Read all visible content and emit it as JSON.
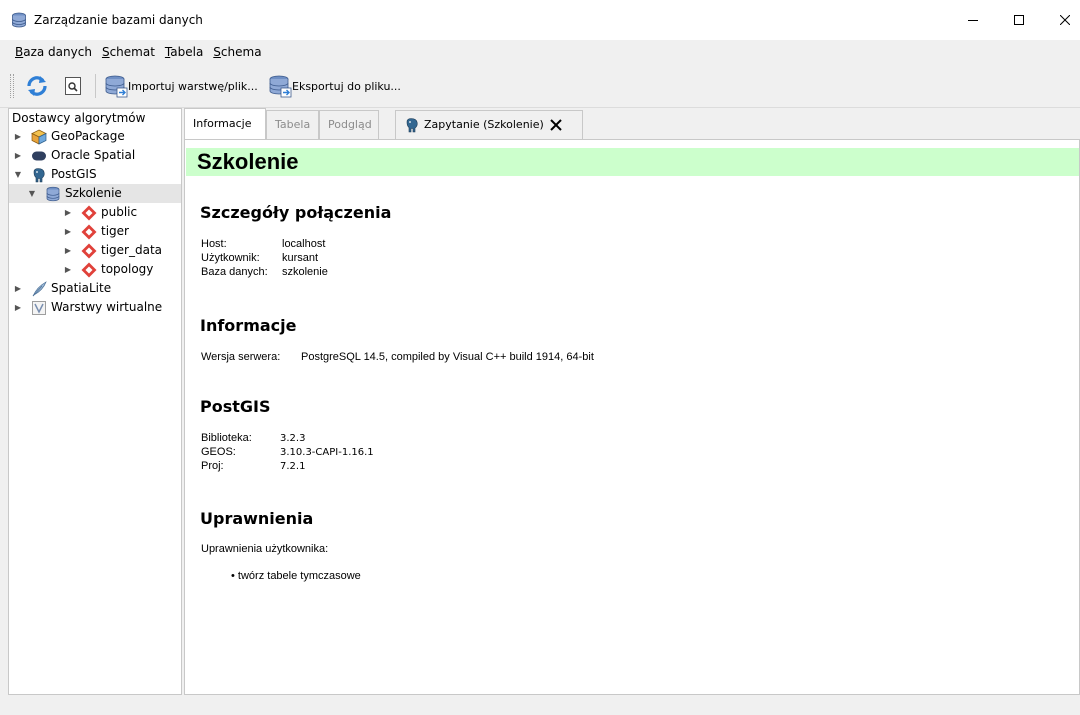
{
  "window": {
    "title": "Zarządzanie bazami danych"
  },
  "menu": {
    "items": [
      {
        "pre": "",
        "ul": "B",
        "post": "aza danych"
      },
      {
        "pre": "",
        "ul": "S",
        "post": "chemat"
      },
      {
        "pre": "",
        "ul": "T",
        "post": "abela"
      },
      {
        "pre": "",
        "ul": "S",
        "post": "chema"
      }
    ]
  },
  "toolbar": {
    "import_label": "Importuj warstwę/plik...",
    "export_label": "Eksportuj do pliku..."
  },
  "sidebar": {
    "header": "Dostawcy algorytmów",
    "items": [
      {
        "label": "GeoPackage"
      },
      {
        "label": "Oracle Spatial"
      },
      {
        "label": "PostGIS"
      },
      {
        "label": "Szkolenie"
      },
      {
        "label": "public"
      },
      {
        "label": "tiger"
      },
      {
        "label": "tiger_data"
      },
      {
        "label": "topology"
      },
      {
        "label": "SpatiaLite"
      },
      {
        "label": "Warstwy wirtualne"
      }
    ]
  },
  "tabs": {
    "info": "Informacje",
    "table": "Tabela",
    "preview": "Podgląd",
    "query": "Zapytanie (Szkolenie)"
  },
  "content": {
    "db_title": "Szkolenie",
    "connection": {
      "title": "Szczegóły połączenia",
      "host_label": "Host:",
      "host_value": "localhost",
      "user_label": "Użytkownik:",
      "user_value": "kursant",
      "db_label": "Baza danych:",
      "db_value": "szkolenie"
    },
    "info": {
      "title": "Informacje",
      "server_label": "Wersja serwera:",
      "server_value": "PostgreSQL 14.5, compiled by Visual C++ build 1914, 64-bit"
    },
    "postgis": {
      "title": "PostGIS",
      "lib_label": "Biblioteka:",
      "lib_value": "3.2.3",
      "geos_label": "GEOS:",
      "geos_value": "3.10.3-CAPI-1.16.1",
      "proj_label": "Proj:",
      "proj_value": "7.2.1"
    },
    "privileges": {
      "title": "Uprawnienia",
      "user_privs_label": "Uprawnienia użytkownika:",
      "items": [
        "twórz tabele tymczasowe"
      ]
    }
  },
  "colors": {
    "title_band": "#ccffcc",
    "schema_icon": "#e0413a",
    "geopackage_icon": "#e8a33a"
  }
}
